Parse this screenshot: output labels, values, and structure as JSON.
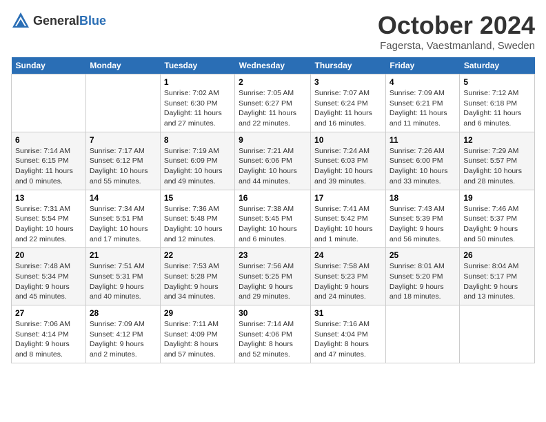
{
  "header": {
    "logo_general": "General",
    "logo_blue": "Blue",
    "month": "October 2024",
    "location": "Fagersta, Vaestmanland, Sweden"
  },
  "columns": [
    "Sunday",
    "Monday",
    "Tuesday",
    "Wednesday",
    "Thursday",
    "Friday",
    "Saturday"
  ],
  "weeks": [
    [
      {
        "day": "",
        "info": ""
      },
      {
        "day": "",
        "info": ""
      },
      {
        "day": "1",
        "info": "Sunrise: 7:02 AM\nSunset: 6:30 PM\nDaylight: 11 hours and 27 minutes."
      },
      {
        "day": "2",
        "info": "Sunrise: 7:05 AM\nSunset: 6:27 PM\nDaylight: 11 hours and 22 minutes."
      },
      {
        "day": "3",
        "info": "Sunrise: 7:07 AM\nSunset: 6:24 PM\nDaylight: 11 hours and 16 minutes."
      },
      {
        "day": "4",
        "info": "Sunrise: 7:09 AM\nSunset: 6:21 PM\nDaylight: 11 hours and 11 minutes."
      },
      {
        "day": "5",
        "info": "Sunrise: 7:12 AM\nSunset: 6:18 PM\nDaylight: 11 hours and 6 minutes."
      }
    ],
    [
      {
        "day": "6",
        "info": "Sunrise: 7:14 AM\nSunset: 6:15 PM\nDaylight: 11 hours and 0 minutes."
      },
      {
        "day": "7",
        "info": "Sunrise: 7:17 AM\nSunset: 6:12 PM\nDaylight: 10 hours and 55 minutes."
      },
      {
        "day": "8",
        "info": "Sunrise: 7:19 AM\nSunset: 6:09 PM\nDaylight: 10 hours and 49 minutes."
      },
      {
        "day": "9",
        "info": "Sunrise: 7:21 AM\nSunset: 6:06 PM\nDaylight: 10 hours and 44 minutes."
      },
      {
        "day": "10",
        "info": "Sunrise: 7:24 AM\nSunset: 6:03 PM\nDaylight: 10 hours and 39 minutes."
      },
      {
        "day": "11",
        "info": "Sunrise: 7:26 AM\nSunset: 6:00 PM\nDaylight: 10 hours and 33 minutes."
      },
      {
        "day": "12",
        "info": "Sunrise: 7:29 AM\nSunset: 5:57 PM\nDaylight: 10 hours and 28 minutes."
      }
    ],
    [
      {
        "day": "13",
        "info": "Sunrise: 7:31 AM\nSunset: 5:54 PM\nDaylight: 10 hours and 22 minutes."
      },
      {
        "day": "14",
        "info": "Sunrise: 7:34 AM\nSunset: 5:51 PM\nDaylight: 10 hours and 17 minutes."
      },
      {
        "day": "15",
        "info": "Sunrise: 7:36 AM\nSunset: 5:48 PM\nDaylight: 10 hours and 12 minutes."
      },
      {
        "day": "16",
        "info": "Sunrise: 7:38 AM\nSunset: 5:45 PM\nDaylight: 10 hours and 6 minutes."
      },
      {
        "day": "17",
        "info": "Sunrise: 7:41 AM\nSunset: 5:42 PM\nDaylight: 10 hours and 1 minute."
      },
      {
        "day": "18",
        "info": "Sunrise: 7:43 AM\nSunset: 5:39 PM\nDaylight: 9 hours and 56 minutes."
      },
      {
        "day": "19",
        "info": "Sunrise: 7:46 AM\nSunset: 5:37 PM\nDaylight: 9 hours and 50 minutes."
      }
    ],
    [
      {
        "day": "20",
        "info": "Sunrise: 7:48 AM\nSunset: 5:34 PM\nDaylight: 9 hours and 45 minutes."
      },
      {
        "day": "21",
        "info": "Sunrise: 7:51 AM\nSunset: 5:31 PM\nDaylight: 9 hours and 40 minutes."
      },
      {
        "day": "22",
        "info": "Sunrise: 7:53 AM\nSunset: 5:28 PM\nDaylight: 9 hours and 34 minutes."
      },
      {
        "day": "23",
        "info": "Sunrise: 7:56 AM\nSunset: 5:25 PM\nDaylight: 9 hours and 29 minutes."
      },
      {
        "day": "24",
        "info": "Sunrise: 7:58 AM\nSunset: 5:23 PM\nDaylight: 9 hours and 24 minutes."
      },
      {
        "day": "25",
        "info": "Sunrise: 8:01 AM\nSunset: 5:20 PM\nDaylight: 9 hours and 18 minutes."
      },
      {
        "day": "26",
        "info": "Sunrise: 8:04 AM\nSunset: 5:17 PM\nDaylight: 9 hours and 13 minutes."
      }
    ],
    [
      {
        "day": "27",
        "info": "Sunrise: 7:06 AM\nSunset: 4:14 PM\nDaylight: 9 hours and 8 minutes."
      },
      {
        "day": "28",
        "info": "Sunrise: 7:09 AM\nSunset: 4:12 PM\nDaylight: 9 hours and 2 minutes."
      },
      {
        "day": "29",
        "info": "Sunrise: 7:11 AM\nSunset: 4:09 PM\nDaylight: 8 hours and 57 minutes."
      },
      {
        "day": "30",
        "info": "Sunrise: 7:14 AM\nSunset: 4:06 PM\nDaylight: 8 hours and 52 minutes."
      },
      {
        "day": "31",
        "info": "Sunrise: 7:16 AM\nSunset: 4:04 PM\nDaylight: 8 hours and 47 minutes."
      },
      {
        "day": "",
        "info": ""
      },
      {
        "day": "",
        "info": ""
      }
    ]
  ]
}
